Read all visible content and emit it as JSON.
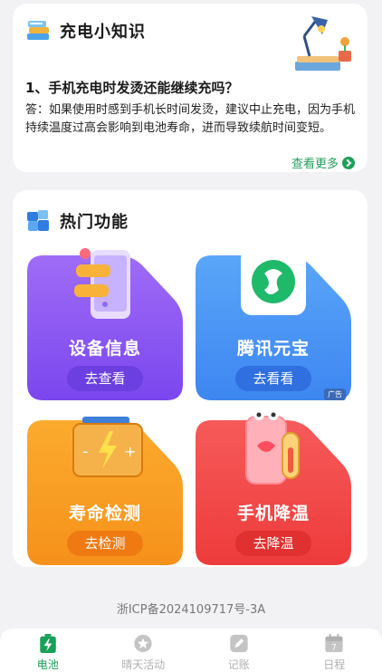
{
  "tips": {
    "title": "充电小知识",
    "question": "1、手机充电时发烫还能继续充吗？",
    "answer": "答：如果使用时感到手机长时间发烫，建议中止充电，因为手机持续温度过高会影响到电池寿命，进而导致续航时间变短。",
    "see_more": "查看更多"
  },
  "features": {
    "title": "热门功能",
    "tiles": [
      {
        "label": "设备信息",
        "button": "去查看",
        "color": "#8b5cf6"
      },
      {
        "label": "腾讯元宝",
        "button": "去看看",
        "color": "#3b8cf5",
        "badge": "广告"
      },
      {
        "label": "寿命检测",
        "button": "去检测",
        "color": "#f79a1e"
      },
      {
        "label": "手机降温",
        "button": "去降温",
        "color": "#f24c4c"
      }
    ]
  },
  "footer": {
    "icp": "浙ICP备2024109717号-3A"
  },
  "tabs": [
    {
      "label": "电池",
      "active": true
    },
    {
      "label": "晴天活动",
      "active": false
    },
    {
      "label": "记账",
      "active": false
    },
    {
      "label": "日程",
      "active": false,
      "icon_text": "7"
    }
  ]
}
